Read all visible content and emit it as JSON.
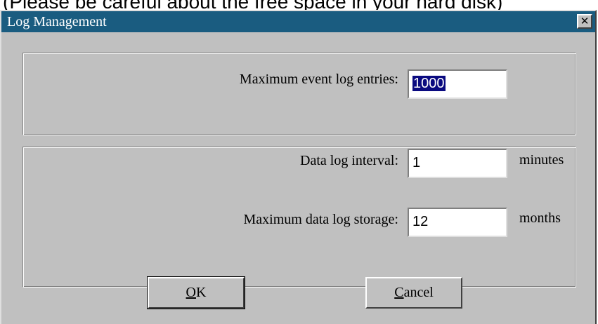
{
  "background_text": "(Please be careful about the free space in your hard disk)",
  "dialog": {
    "title": "Log Management",
    "close_glyph": "✕"
  },
  "event_log": {
    "max_entries_label": "Maximum event log entries:",
    "max_entries_value": "1000"
  },
  "data_log": {
    "interval_label": "Data log interval:",
    "interval_value": "1",
    "interval_unit": "minutes",
    "storage_label": "Maximum data log storage:",
    "storage_value": "12",
    "storage_unit": "months"
  },
  "buttons": {
    "ok_mnemonic": "O",
    "ok_rest": "K",
    "cancel_mnemonic": "C",
    "cancel_rest": "ancel"
  }
}
